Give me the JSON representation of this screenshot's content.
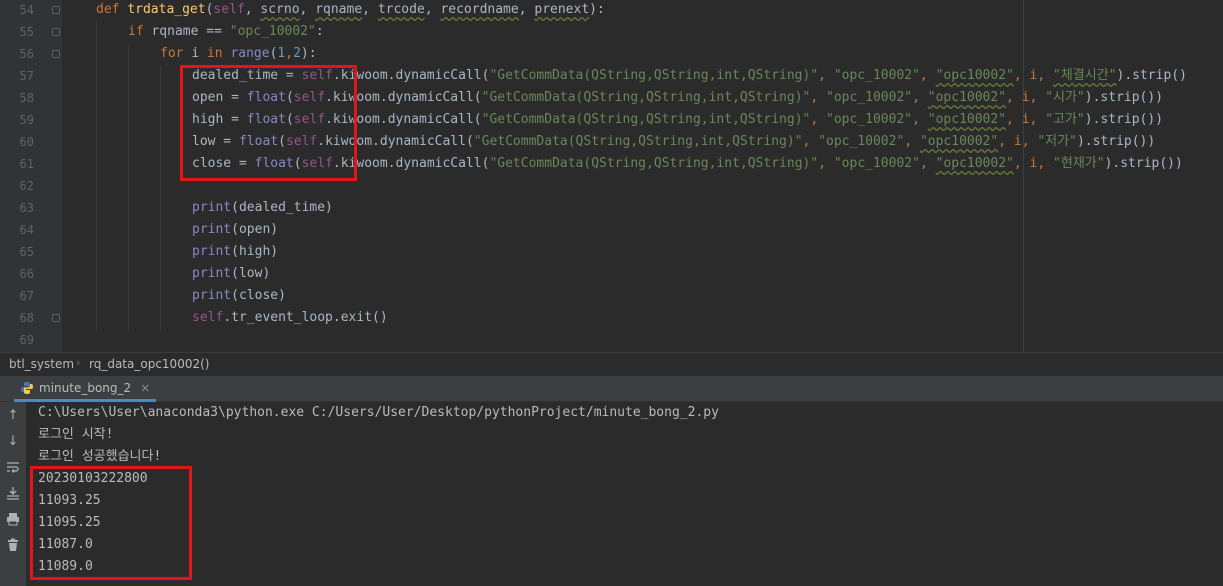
{
  "editor": {
    "line_numbers": [
      "54",
      "55",
      "56",
      "57",
      "58",
      "59",
      "60",
      "61",
      "62",
      "63",
      "64",
      "65",
      "66",
      "67",
      "68",
      "69"
    ],
    "lines": {
      "l54": {
        "def": "def ",
        "name": "trdata_get",
        "open": "(",
        "self": "self",
        "sep1": ", ",
        "p1": "scrno",
        "sep2": ", ",
        "p2": "rqname",
        "sep3": ", ",
        "p3": "trcode",
        "sep4": ", ",
        "p4": "recordname",
        "sep5": ", ",
        "p5": "prenext",
        "close": "):"
      },
      "l55": {
        "kw": "if ",
        "rest": "rqname == ",
        "str": "\"opc_10002\"",
        "colon": ":"
      },
      "l56": {
        "kw": "for ",
        "var": "i ",
        "in": "in ",
        "range": "range",
        "open": "(",
        "n1": "1",
        "comma": ",",
        "n2": "2",
        "close": "):"
      },
      "l57": {
        "var": "dealed_time = ",
        "self": "self",
        "mid": ".kiwoom.dynamicCall(",
        "s1": "\"GetCommData(QString,QString,int,QString)\"",
        "c1": ", ",
        "s2": "\"opc_10002\"",
        "c2": ", ",
        "s3": "\"opc10002\"",
        "c3": ", i, ",
        "s4": "\"체결시간\"",
        "end": ").strip()"
      },
      "l58": {
        "var": "open = ",
        "float": "float",
        "p": "(",
        "self": "self",
        "mid": ".kiwoom.dynamicCall(",
        "s1": "\"GetCommData(QString,QString,int,QString)\"",
        "c1": ", ",
        "s2": "\"opc_10002\"",
        "c2": ", ",
        "s3": "\"opc10002\"",
        "c3": ", i, ",
        "s4": "\"시가\"",
        "end": ").strip())"
      },
      "l59": {
        "var": "high = ",
        "float": "float",
        "p": "(",
        "self": "self",
        "mid": ".kiwoom.dynamicCall(",
        "s1": "\"GetCommData(QString,QString,int,QString)\"",
        "c1": ", ",
        "s2": "\"opc_10002\"",
        "c2": ", ",
        "s3": "\"opc10002\"",
        "c3": ", i, ",
        "s4": "\"고가\"",
        "end": ").strip())"
      },
      "l60": {
        "var": "low = ",
        "float": "float",
        "p": "(",
        "self": "self",
        "mid": ".kiwoom.dynamicCall(",
        "s1": "\"GetCommData(QString,QString,int,QString)\"",
        "c1": ", ",
        "s2": "\"opc_10002\"",
        "c2": ", ",
        "s3": "\"opc10002\"",
        "c3": ", i, ",
        "s4": "\"저가\"",
        "end": ").strip())"
      },
      "l61": {
        "var": "close = ",
        "float": "float",
        "p": "(",
        "self": "self",
        "mid": ".kiwoom.dynamicCall(",
        "s1": "\"GetCommData(QString,QString,int,QString)\"",
        "c1": ", ",
        "s2": "\"opc_10002\"",
        "c2": ", ",
        "s3": "\"opc10002\"",
        "c3": ", i, ",
        "s4": "\"현재가\"",
        "end": ").strip())"
      },
      "l63": {
        "fn": "print",
        "arg": "(dealed_time)"
      },
      "l64": {
        "fn": "print",
        "arg": "(open)"
      },
      "l65": {
        "fn": "print",
        "arg": "(high)"
      },
      "l66": {
        "fn": "print",
        "arg": "(low)"
      },
      "l67": {
        "fn": "print",
        "arg": "(close)"
      },
      "l68": {
        "self": "self",
        "rest": ".tr_event_loop.exit()"
      }
    }
  },
  "breadcrumb": {
    "item1": "btl_system",
    "separator": "›",
    "item2": "rq_data_opc10002()"
  },
  "run": {
    "tab_label": "minute_bong_2",
    "tab_close": "×",
    "icons": [
      "arrow-up-icon",
      "arrow-down-icon",
      "soft-wrap-icon",
      "scroll-to-end-icon",
      "print-icon",
      "trash-icon"
    ],
    "output": [
      "C:\\Users\\User\\anaconda3\\python.exe C:/Users/User/Desktop/pythonProject/minute_bong_2.py",
      "로그인 시작!",
      "로그인 성공했습니다!",
      "20230103222800",
      "11093.25",
      "11095.25",
      "11087.0",
      "11089.0"
    ]
  },
  "colors": {
    "highlight_box": "#e3141b",
    "keyword": "#cc7832",
    "string": "#6a8759",
    "self": "#94558d",
    "function": "#ffc66d"
  }
}
